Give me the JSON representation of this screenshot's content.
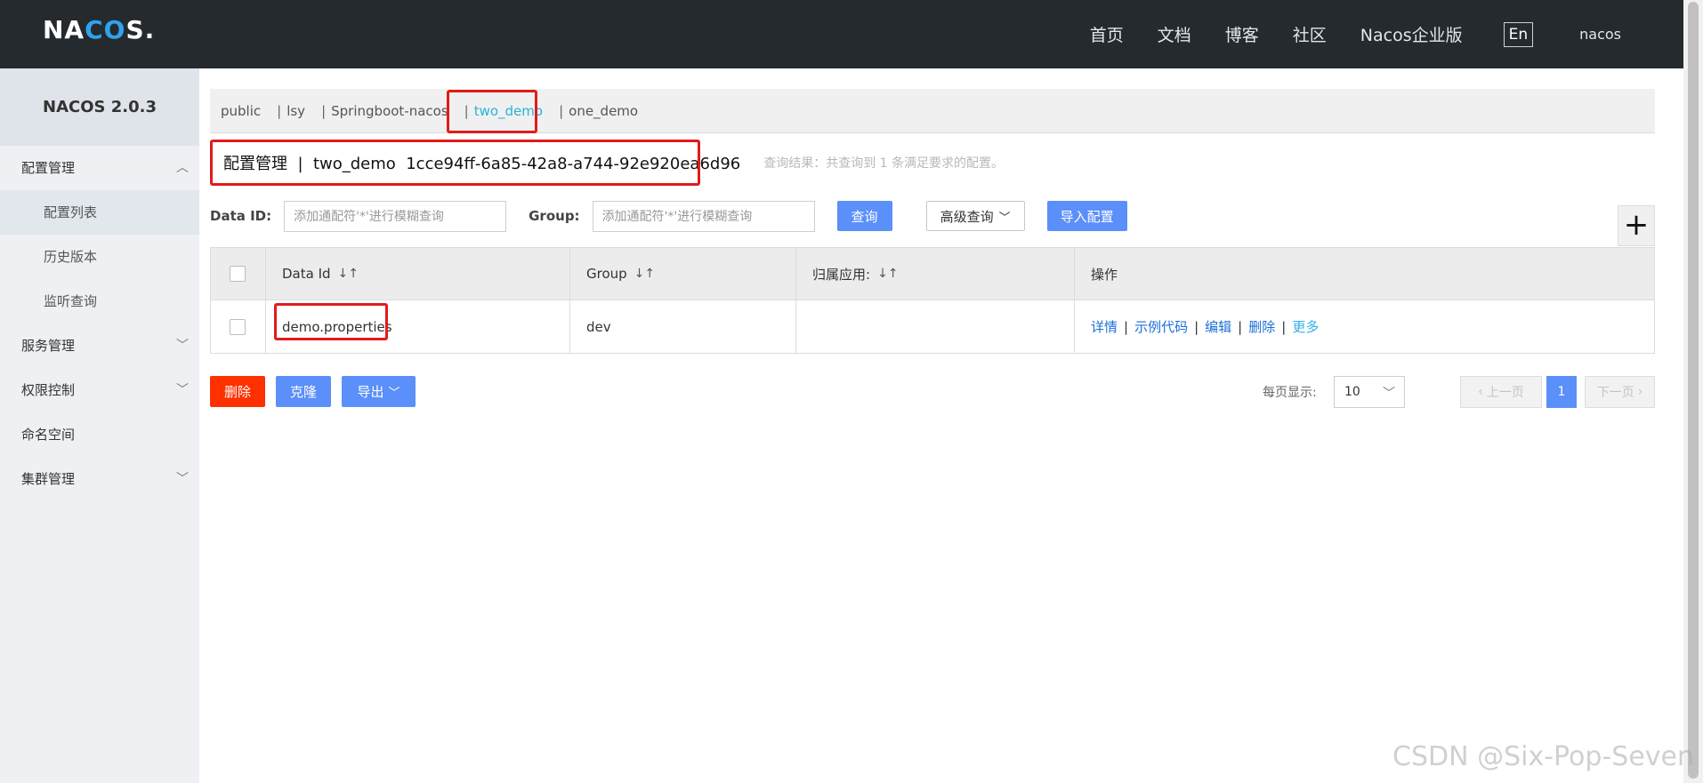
{
  "brand": {
    "logo_pre": "NA",
    "logo_mid": "CO",
    "logo_post": "S."
  },
  "topnav": {
    "items": [
      "首页",
      "文档",
      "博客",
      "社区",
      "Nacos企业版"
    ],
    "lang": "En",
    "user": "nacos"
  },
  "sidebar": {
    "title": "NACOS 2.0.3",
    "items": [
      {
        "label": "配置管理",
        "chevron": "︿"
      },
      {
        "label": "配置列表"
      },
      {
        "label": "历史版本"
      },
      {
        "label": "监听查询"
      },
      {
        "label": "服务管理",
        "chevron": "﹀"
      },
      {
        "label": "权限控制",
        "chevron": "﹀"
      },
      {
        "label": "命名空间"
      },
      {
        "label": "集群管理",
        "chevron": "﹀"
      }
    ]
  },
  "namespaces": [
    "public",
    "|",
    "lsy",
    "|",
    "Springboot-nacos",
    "|",
    "two_demo",
    "|",
    "one_demo"
  ],
  "title": {
    "text": "配置管理  |  two_demo  1cce94ff-6a85-42a8-a744-92e920ea6d96",
    "result": "查询结果：共查询到 1 条满足要求的配置。"
  },
  "search": {
    "dataid_label": "Data ID:",
    "dataid_placeholder": "添加通配符'*'进行模糊查询",
    "group_label": "Group:",
    "group_placeholder": "添加通配符'*'进行模糊查询",
    "query_btn": "查询",
    "advanced_btn": "高级查询",
    "import_btn": "导入配置",
    "plus": "+"
  },
  "table": {
    "headers": [
      "Data Id",
      "Group",
      "归属应用:",
      "操作"
    ],
    "sort_icon": "↓↑",
    "rows": [
      {
        "data_id": "demo.properties",
        "group": "dev",
        "app": "",
        "ops": [
          "详情",
          "示例代码",
          "编辑",
          "删除",
          "更多"
        ]
      }
    ]
  },
  "actions": {
    "delete": "删除",
    "clone": "克隆",
    "export": "导出"
  },
  "pagination": {
    "per_page_label": "每页显示:",
    "per_page": "10",
    "prev": "上一页",
    "current": "1",
    "next": "下一页"
  },
  "watermark": "CSDN @Six-Pop-Seven",
  "colors": {
    "accent": "#5b8ff9",
    "danger": "#ff3000",
    "highlight": "#e11b1b",
    "topbar": "#252a2f"
  }
}
